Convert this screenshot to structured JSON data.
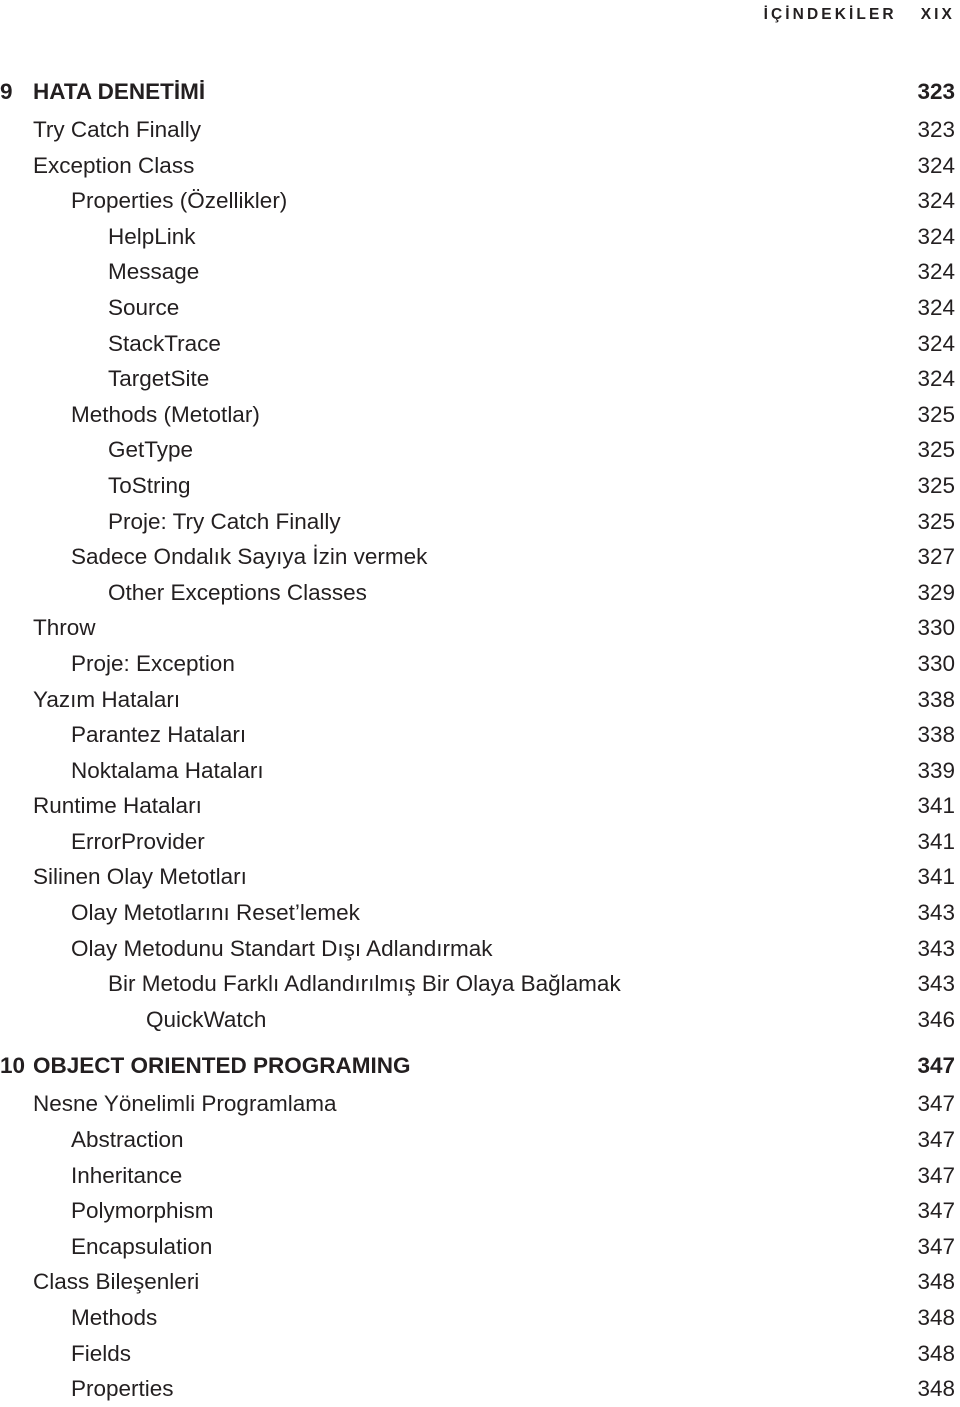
{
  "running_head": {
    "title": "İÇİNDEKİLER",
    "folio": "XIX"
  },
  "toc": {
    "entries": [
      {
        "number": "9",
        "label": "HATA DENETİMİ",
        "page": "323",
        "level": 1,
        "kind": "chapter"
      },
      {
        "number": "",
        "label": "Try Catch Finally",
        "page": "323",
        "level": 1,
        "kind": "entry"
      },
      {
        "number": "",
        "label": "Exception Class",
        "page": "324",
        "level": 1,
        "kind": "entry"
      },
      {
        "number": "",
        "label": "Properties (Özellikler)",
        "page": "324",
        "level": 2,
        "kind": "entry"
      },
      {
        "number": "",
        "label": "HelpLink",
        "page": "324",
        "level": 3,
        "kind": "entry"
      },
      {
        "number": "",
        "label": "Message",
        "page": "324",
        "level": 3,
        "kind": "entry"
      },
      {
        "number": "",
        "label": "Source",
        "page": "324",
        "level": 3,
        "kind": "entry"
      },
      {
        "number": "",
        "label": "StackTrace",
        "page": "324",
        "level": 3,
        "kind": "entry"
      },
      {
        "number": "",
        "label": "TargetSite",
        "page": "324",
        "level": 3,
        "kind": "entry"
      },
      {
        "number": "",
        "label": "Methods (Metotlar)",
        "page": "325",
        "level": 2,
        "kind": "entry"
      },
      {
        "number": "",
        "label": "GetType",
        "page": "325",
        "level": 3,
        "kind": "entry"
      },
      {
        "number": "",
        "label": "ToString",
        "page": "325",
        "level": 3,
        "kind": "entry"
      },
      {
        "number": "",
        "label": "Proje: Try Catch Finally",
        "page": "325",
        "level": 3,
        "kind": "entry"
      },
      {
        "number": "",
        "label": "Sadece Ondalık Sayıya İzin vermek",
        "page": "327",
        "level": 2,
        "kind": "entry"
      },
      {
        "number": "",
        "label": "Other Exceptions Classes",
        "page": "329",
        "level": 3,
        "kind": "entry"
      },
      {
        "number": "",
        "label": "Throw",
        "page": "330",
        "level": 1,
        "kind": "entry"
      },
      {
        "number": "",
        "label": "Proje: Exception",
        "page": "330",
        "level": 2,
        "kind": "entry"
      },
      {
        "number": "",
        "label": "Yazım Hataları",
        "page": "338",
        "level": 1,
        "kind": "entry"
      },
      {
        "number": "",
        "label": "Parantez Hataları",
        "page": "338",
        "level": 2,
        "kind": "entry"
      },
      {
        "number": "",
        "label": "Noktalama Hataları",
        "page": "339",
        "level": 2,
        "kind": "entry"
      },
      {
        "number": "",
        "label": "Runtime Hataları",
        "page": "341",
        "level": 1,
        "kind": "entry"
      },
      {
        "number": "",
        "label": "ErrorProvider",
        "page": "341",
        "level": 2,
        "kind": "entry"
      },
      {
        "number": "",
        "label": "Silinen Olay Metotları",
        "page": "341",
        "level": 1,
        "kind": "entry"
      },
      {
        "number": "",
        "label": "Olay Metotlarını Reset’lemek",
        "page": "343",
        "level": 2,
        "kind": "entry"
      },
      {
        "number": "",
        "label": "Olay Metodunu Standart Dışı Adlandırmak",
        "page": "343",
        "level": 2,
        "kind": "entry"
      },
      {
        "number": "",
        "label": "Bir Metodu Farklı Adlandırılmış Bir Olaya Bağlamak",
        "page": "343",
        "level": 3,
        "kind": "entry"
      },
      {
        "number": "",
        "label": "QuickWatch",
        "page": "346",
        "level": 4,
        "kind": "entry"
      },
      {
        "number": "10",
        "label": "OBJECT ORIENTED PROGRAMING",
        "page": "347",
        "level": 1,
        "kind": "chapter"
      },
      {
        "number": "",
        "label": "Nesne Yönelimli Programlama",
        "page": "347",
        "level": 1,
        "kind": "entry"
      },
      {
        "number": "",
        "label": "Abstraction",
        "page": "347",
        "level": 2,
        "kind": "entry"
      },
      {
        "number": "",
        "label": "Inheritance",
        "page": "347",
        "level": 2,
        "kind": "entry"
      },
      {
        "number": "",
        "label": "Polymorphism",
        "page": "347",
        "level": 2,
        "kind": "entry"
      },
      {
        "number": "",
        "label": "Encapsulation",
        "page": "347",
        "level": 2,
        "kind": "entry"
      },
      {
        "number": "",
        "label": "Class Bileşenleri",
        "page": "348",
        "level": 1,
        "kind": "entry"
      },
      {
        "number": "",
        "label": "Methods",
        "page": "348",
        "level": 2,
        "kind": "entry"
      },
      {
        "number": "",
        "label": "Fields",
        "page": "348",
        "level": 2,
        "kind": "entry"
      },
      {
        "number": "",
        "label": "Properties",
        "page": "348",
        "level": 2,
        "kind": "entry"
      }
    ]
  }
}
